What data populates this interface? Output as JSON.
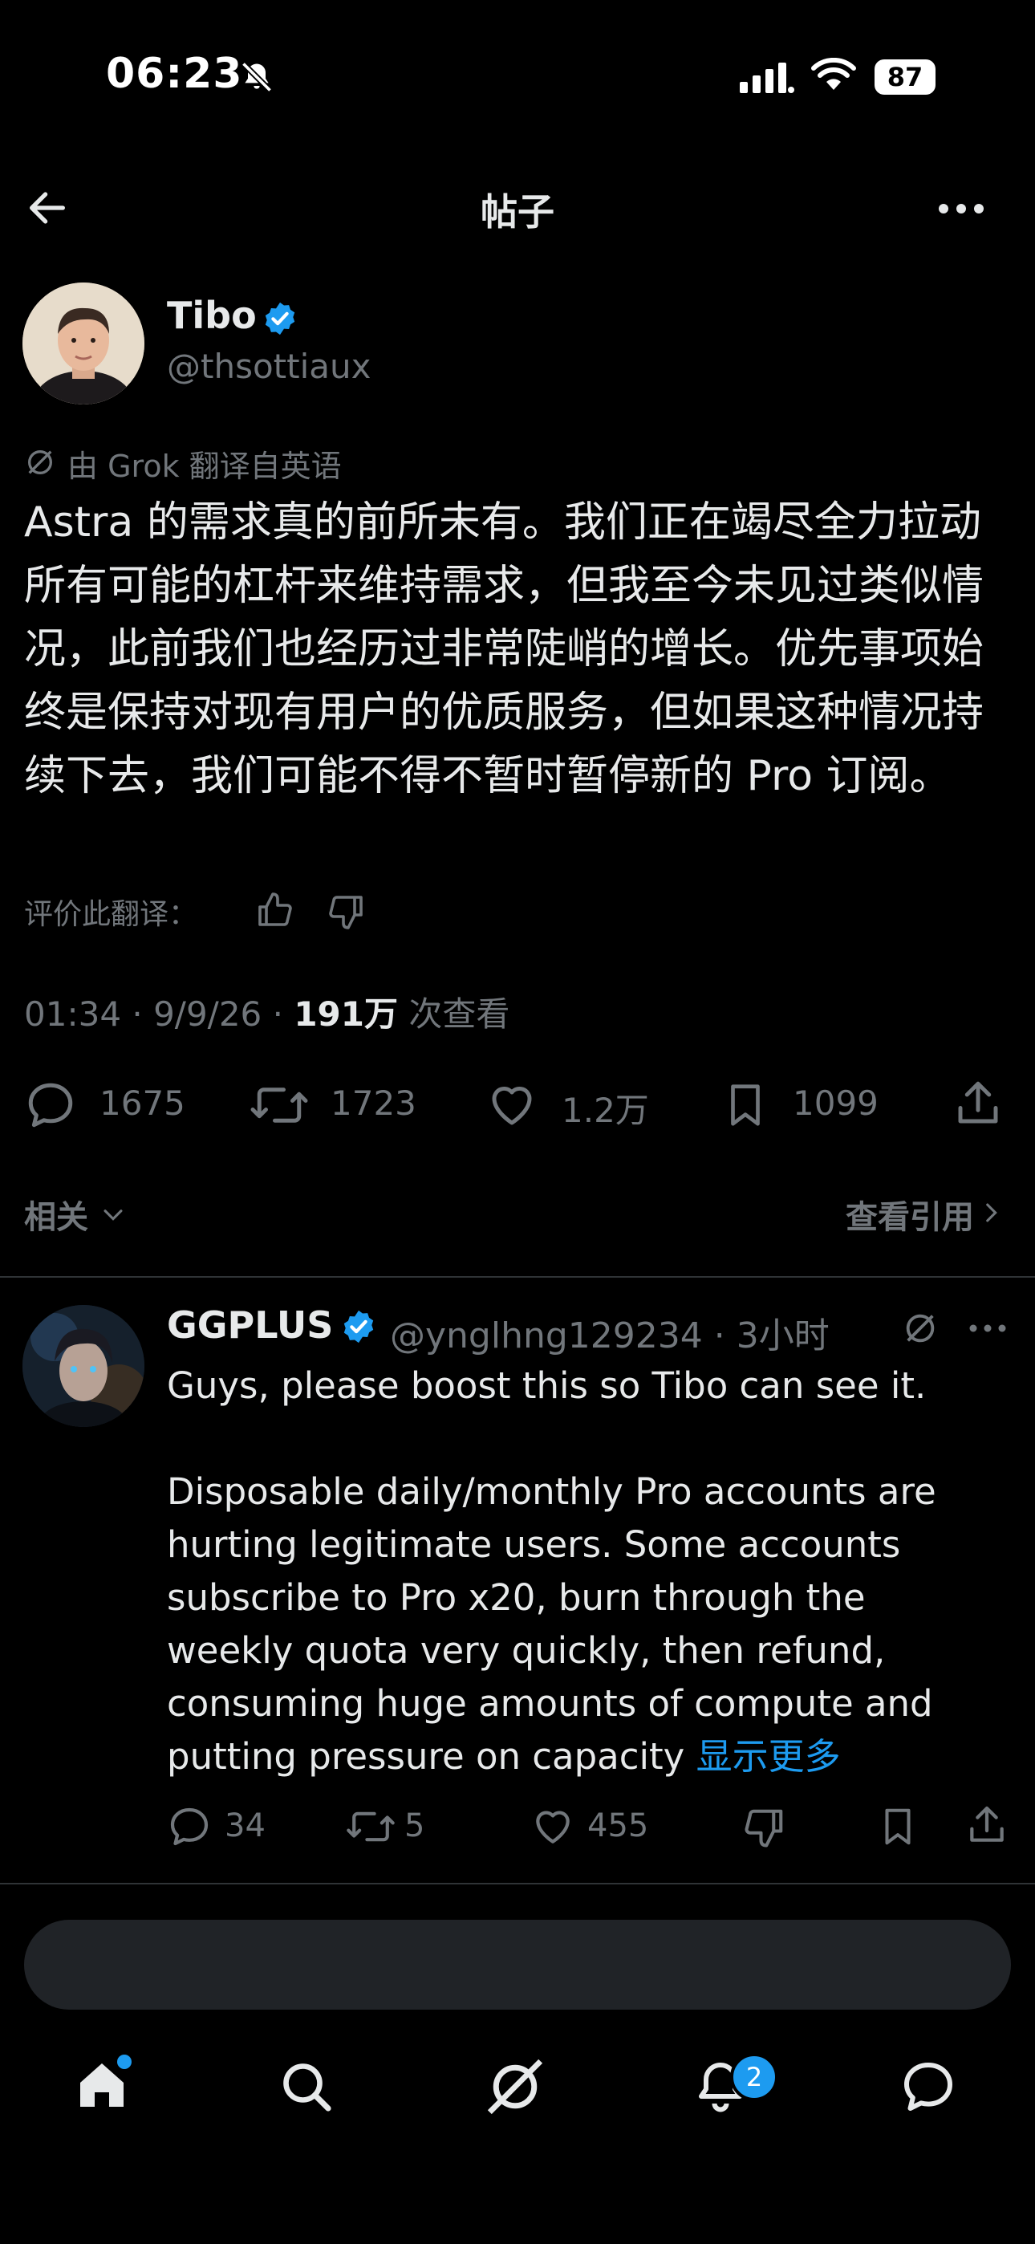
{
  "status_bar": {
    "time": "06:23",
    "battery": "87"
  },
  "nav": {
    "title": "帖子"
  },
  "post": {
    "author_name": "Tibo",
    "author_handle": "@thsottiaux",
    "translated_label": "由 Grok 翻译自英语",
    "body": "Astra 的需求真的前所未有。我们正在竭尽全力拉动所有可能的杠杆来维持需求，但我至今未见过类似情况，此前我们也经历过非常陡峭的增长。优先事项始终是保持对现有用户的优质服务，但如果这种情况持续下去，我们可能不得不暂时暂停新的 Pro 订阅。",
    "rate_label": "评价此翻译：",
    "time": "01:34 · 9/9/26 · ",
    "views_value": "191万",
    "views_label": " 次查看",
    "replies": "1675",
    "reposts": "1723",
    "likes": "1.2万",
    "bookmarks": "1099"
  },
  "related": {
    "related_label": "相关",
    "view_quotes_label": "查看引用"
  },
  "reply": {
    "author_name": "GGPLUS",
    "handle_time": "@ynglhng129234 · 3小时",
    "line1": "Guys, please boost this so Tibo can see it.",
    "paragraph": "Disposable daily/monthly Pro accounts are hurting legitimate users. Some accounts subscribe to Pro x20, burn through the weekly quota very quickly, then refund, consuming huge amounts of compute and putting pressure on capacity ",
    "show_more": "显示更多",
    "replies": "34",
    "reposts": "5",
    "likes": "455"
  },
  "tabbar": {
    "notifications_badge": "2"
  },
  "colors": {
    "accent": "#1d9bf0",
    "background": "#000000",
    "secondary_text": "#71767b"
  }
}
